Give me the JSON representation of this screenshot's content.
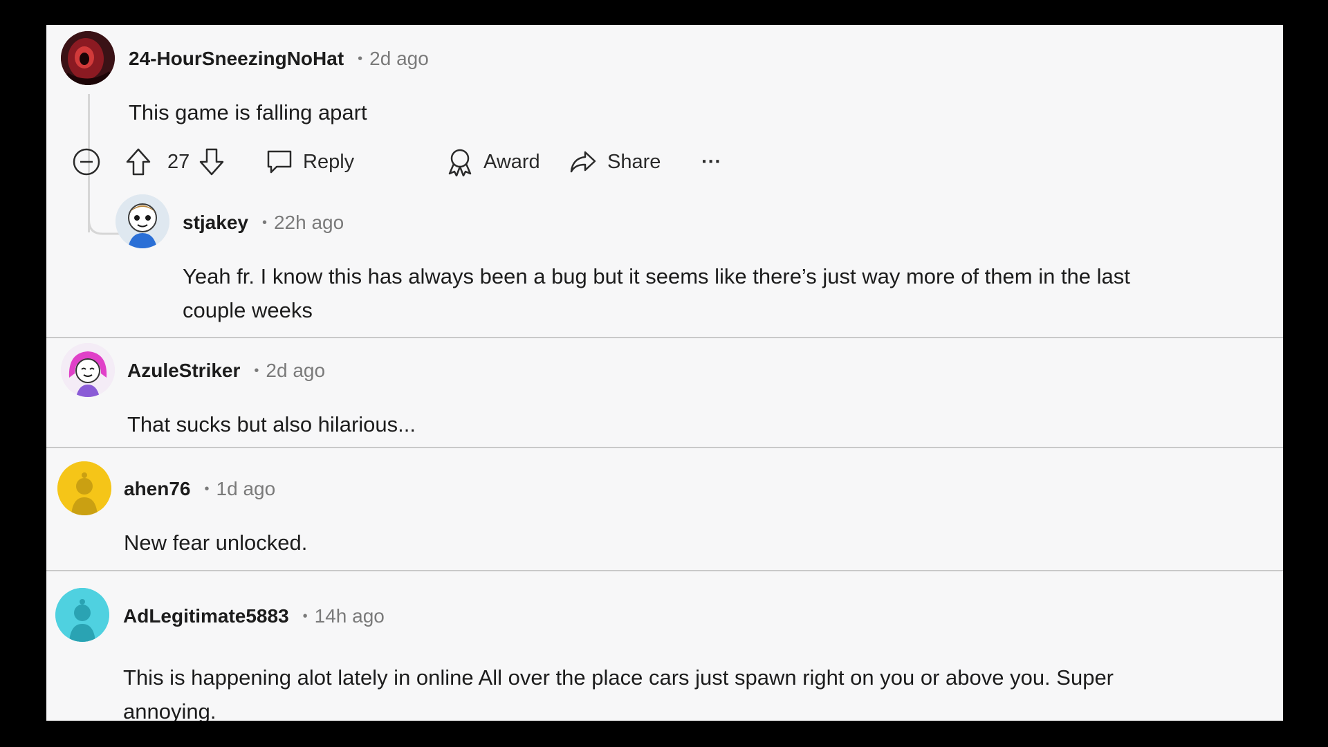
{
  "comments": [
    {
      "username": "24-HourSneezingNoHat",
      "dot": "•",
      "time": "2d ago",
      "text": "This game is falling apart",
      "avatar_icon": "dark-red-creature-avatar",
      "actions": {
        "collapse_icon": "minus-circle-icon",
        "votes": "27",
        "reply": "Reply",
        "award": "Award",
        "share": "Share",
        "more": "···"
      },
      "replies": [
        {
          "username": "stjakey",
          "dot": "•",
          "time": "22h ago",
          "text_line1": "Yeah fr. I know this has always been a bug but it seems like there’s just way more of them in the last",
          "text_line2": "couple weeks",
          "avatar_icon": "cartoon-snoo-avatar"
        }
      ]
    },
    {
      "username": "AzuleStriker",
      "dot": "•",
      "time": "2d ago",
      "text": "That sucks but also hilarious...",
      "avatar_icon": "pink-hair-snoo-avatar"
    },
    {
      "username": "ahen76",
      "dot": "•",
      "time": "1d ago",
      "text": "New fear unlocked.",
      "avatar_icon": "yellow-default-snoo-avatar",
      "avatar_color": "#f5c518"
    },
    {
      "username": "AdLegitimate5883",
      "dot": "•",
      "time": "14h ago",
      "text_line1": "This is happening alot lately in online All over the place cars just spawn right on you or above you. Super",
      "text_line2": "annoying.",
      "avatar_icon": "teal-default-snoo-avatar",
      "avatar_color": "#4fd1e0"
    }
  ]
}
